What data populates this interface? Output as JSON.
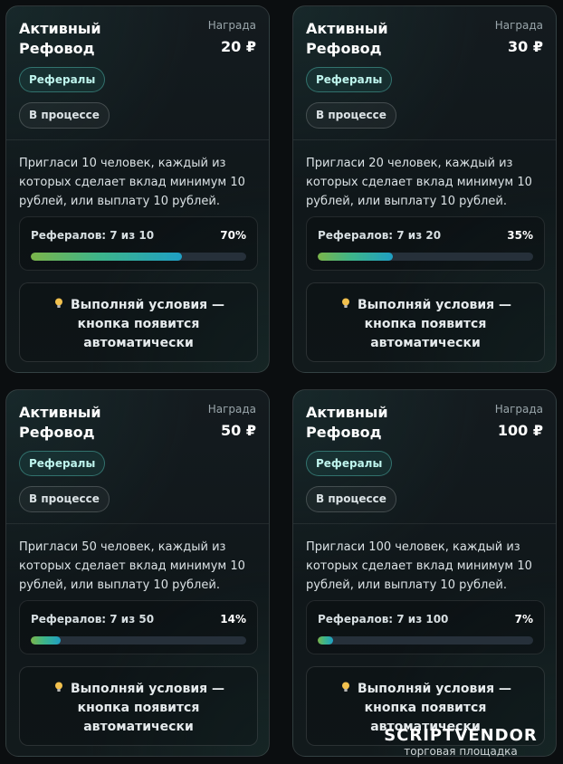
{
  "cards": [
    {
      "title": "Активный Рефовод",
      "reward_label": "Награда",
      "reward_value": "20 ₽",
      "tag": "Рефералы",
      "status": "В процессе",
      "description": "Пригласи 10 человек, каждый из которых сделает вклад минимум 10 рублей, или выплату 10 рублей.",
      "progress_label": "Рефералов: 7 из 10",
      "progress_percent_text": "70%",
      "progress": 0.7,
      "hint_icon": "bulb-icon",
      "hint": "Выполняй условия — кнопка появится автоматически"
    },
    {
      "title": "Активный Рефовод",
      "reward_label": "Награда",
      "reward_value": "30 ₽",
      "tag": "Рефералы",
      "status": "В процессе",
      "description": "Пригласи 20 человек, каждый из которых сделает вклад минимум 10 рублей, или выплату 10 рублей.",
      "progress_label": "Рефералов: 7 из 20",
      "progress_percent_text": "35%",
      "progress": 0.35,
      "hint_icon": "bulb-icon",
      "hint": "Выполняй условия — кнопка появится автоматически"
    },
    {
      "title": "Активный Рефовод",
      "reward_label": "Награда",
      "reward_value": "50 ₽",
      "tag": "Рефералы",
      "status": "В процессе",
      "description": "Пригласи 50 человек, каждый из которых сделает вклад минимум 10 рублей, или выплату 10 рублей.",
      "progress_label": "Рефералов: 7 из 50",
      "progress_percent_text": "14%",
      "progress": 0.14,
      "hint_icon": "bulb-icon",
      "hint": "Выполняй условия — кнопка появится автоматически"
    },
    {
      "title": "Активный Рефовод",
      "reward_label": "Награда",
      "reward_value": "100 ₽",
      "tag": "Рефералы",
      "status": "В процессе",
      "description": "Пригласи 100 человек, каждый из которых сделает вклад минимум 10 рублей, или выплату 10 рублей.",
      "progress_label": "Рефералов: 7 из 100",
      "progress_percent_text": "7%",
      "progress": 0.07,
      "hint_icon": "bulb-icon",
      "hint": "Выполняй условия — кнопка появится автоматически"
    }
  ],
  "watermark": {
    "brand": "SCRIPTVENDOR",
    "subtitle": "торговая площадка"
  },
  "colors": {
    "accent": "#3db58a",
    "progress_start": "#7bb54a",
    "progress_end": "#1f9fc4",
    "tag_border": "#48aaa0"
  }
}
